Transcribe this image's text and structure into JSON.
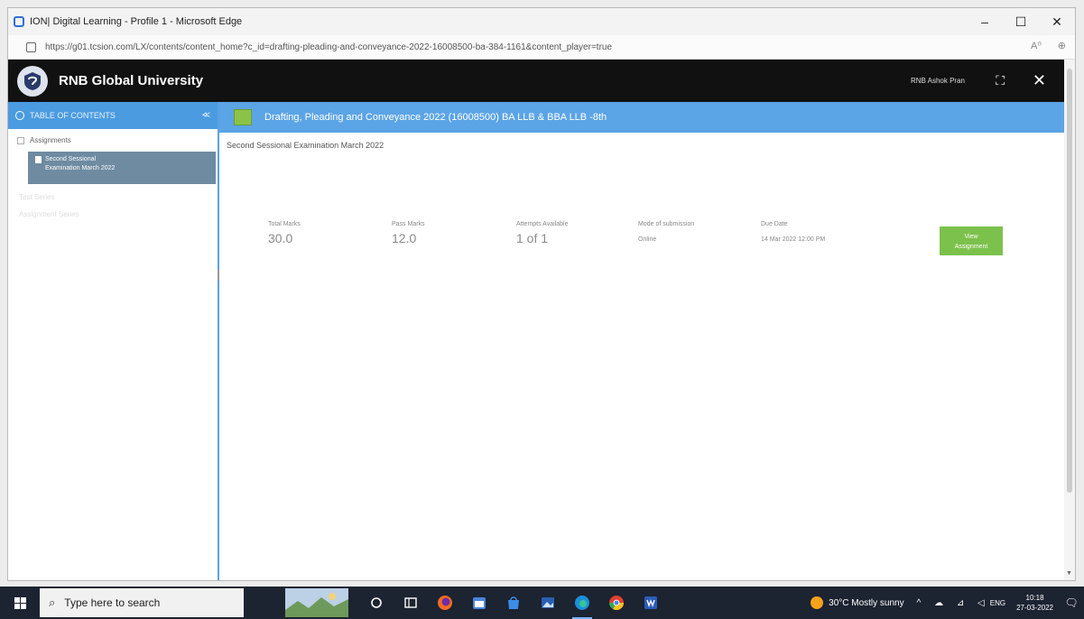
{
  "browser": {
    "window_title": "ION| Digital Learning - Profile 1 - Microsoft Edge",
    "url": "https://g01.tcsion.com/LX/contents/content_home?c_id=drafting-pleading-and-conveyance-2022-16008500-ba-384-1161&content_player=true",
    "minimize": "–",
    "maximize": "☐",
    "close": "✕",
    "read_aloud": "A⁰",
    "zoom": "⊕"
  },
  "app": {
    "university": "RNB Global University",
    "user": "RNB Ashok Pran",
    "expand_icon": "⛶",
    "close_icon": "✕"
  },
  "sidebar": {
    "header": "TABLE OF CONTENTS",
    "collapse": "≪",
    "root": "Assignments",
    "selected_line1": "Second Sessional",
    "selected_line2": "Examination March 2022",
    "faded1": "Test Series",
    "faded2": "Assignment Series"
  },
  "main": {
    "course_title": "Drafting, Pleading and Conveyance 2022 (16008500) BA LLB & BBA LLB -8th",
    "assignment_title": "Second Sessional Examination March 2022",
    "total_marks_label": "Total Marks",
    "total_marks": "30.0",
    "pass_marks_label": "Pass Marks",
    "pass_marks": "12.0",
    "attempts_label": "Attempts Available",
    "attempts": "1 of 1",
    "mode_label": "Mode of submission",
    "mode": "Online",
    "due_label": "Due Date",
    "due": "14 Mar 2022 12:00 PM",
    "view_btn_line1": "View",
    "view_btn_line2": "Assignment"
  },
  "taskbar": {
    "search_placeholder": "Type here to search",
    "weather": "30°C  Mostly sunny",
    "tray_icons": "^ ☁ ⊿ ◁",
    "lang": "ENG",
    "time": "10:18",
    "date": "27-03-2022",
    "notification": "🗨"
  }
}
